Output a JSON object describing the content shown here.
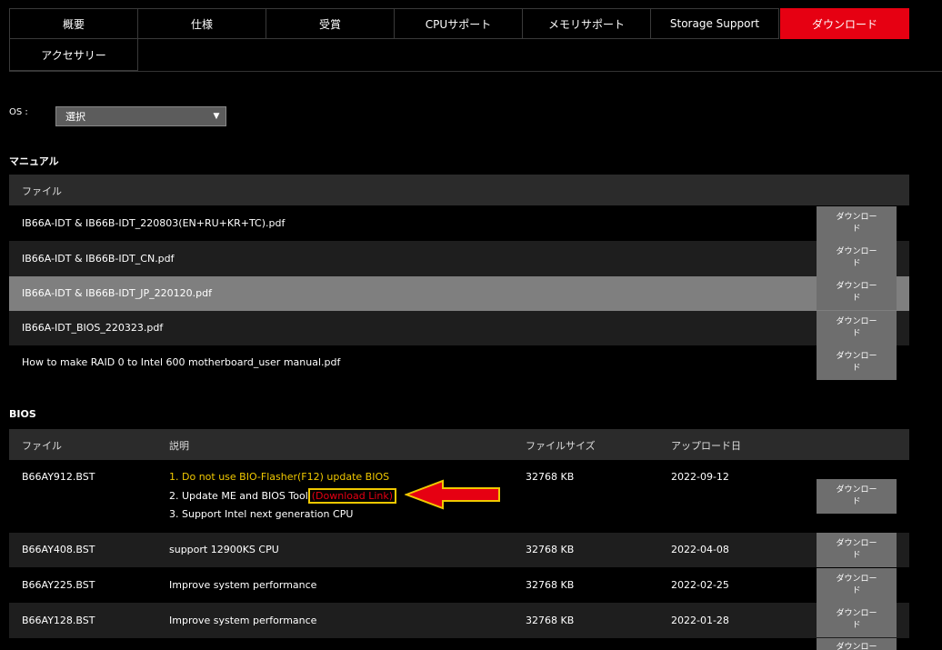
{
  "tabs": [
    {
      "label": "概要"
    },
    {
      "label": "仕様"
    },
    {
      "label": "受賞"
    },
    {
      "label": "CPUサポート"
    },
    {
      "label": "メモリサポート"
    },
    {
      "label": "Storage Support"
    },
    {
      "label": "ダウンロード"
    },
    {
      "label": "アクセサリー"
    }
  ],
  "os": {
    "label": "OS :",
    "selected": "選択"
  },
  "manual": {
    "title": "マニュアル",
    "header": "ファイル",
    "rows": [
      {
        "file": "IB66A-IDT & IB66B-IDT_220803(EN+RU+KR+TC).pdf"
      },
      {
        "file": "IB66A-IDT & IB66B-IDT_CN.pdf"
      },
      {
        "file": "IB66A-IDT & IB66B-IDT_JP_220120.pdf"
      },
      {
        "file": "IB66A-IDT_BIOS_220323.pdf"
      },
      {
        "file": "How to make RAID 0 to Intel 600 motherboard_user manual.pdf"
      }
    ]
  },
  "download_label": "ダウンロード",
  "bios": {
    "title": "BIOS",
    "headers": {
      "file": "ファイル",
      "desc": "説明",
      "size": "ファイルサイズ",
      "date": "アップロード日"
    },
    "rows": [
      {
        "file": "B66AY912.BST",
        "desc1": "1. Do not use BIO-Flasher(F12) update BIOS",
        "desc2": "2. Update ME and BIOS Tool",
        "link_open": "(",
        "link": "Download Link",
        "link_close": ")",
        "desc3": "3. Support Intel next generation CPU",
        "size": "32768 KB",
        "date": "2022-09-12"
      },
      {
        "file": "B66AY408.BST",
        "desc": "support 12900KS CPU",
        "size": "32768 KB",
        "date": "2022-04-08"
      },
      {
        "file": "B66AY225.BST",
        "desc": "Improve system performance",
        "size": "32768 KB",
        "date": "2022-02-25"
      },
      {
        "file": "B66AY128.BST",
        "desc": "Improve system performance",
        "size": "32768 KB",
        "date": "2022-01-28"
      }
    ]
  },
  "colors": {
    "accent": "#e60012",
    "highlight": "#f0c800"
  }
}
